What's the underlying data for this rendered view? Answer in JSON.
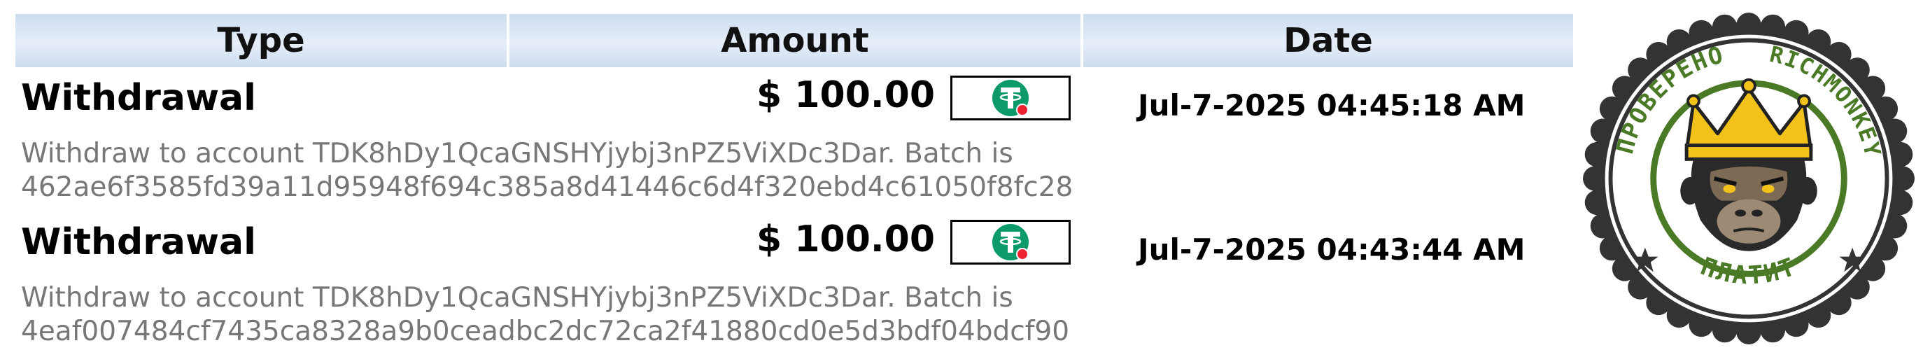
{
  "table": {
    "headers": {
      "type": "Type",
      "amount": "Amount",
      "date": "Date"
    },
    "rows": [
      {
        "type": "Withdrawal",
        "amount": "$ 100.00",
        "payment_method_icon": "tether-usdt-trc20-icon",
        "date": "Jul-7-2025 04:45:18 AM",
        "description_line1": "Withdraw to account TDK8hDy1QcaGNSHYjybj3nPZ5ViXDc3Dar. Batch is",
        "description_line2": "462ae6f3585fd39a11d95948f694c385a8d41446c6d4f320ebd4c61050f8fc28"
      },
      {
        "type": "Withdrawal",
        "amount": "$ 100.00",
        "payment_method_icon": "tether-usdt-trc20-icon",
        "date": "Jul-7-2025 04:43:44 AM",
        "description_line1": "Withdraw to account TDK8hDy1QcaGNSHYjybj3nPZ5ViXDc3Dar. Batch is",
        "description_line2": "4eaf007484cf7435ca8328a9b0ceadbc2dc72ca2f41880cd0e5d3bdf04bdcf90"
      }
    ]
  },
  "badge": {
    "top_left_text": "ПРОВЕРЕНО",
    "top_right_text": "RICHMONKEY",
    "bottom_text": "ПЛАТИТ",
    "icon": "crowned-gorilla-icon"
  },
  "colors": {
    "header_gradient": "#d6e3f3",
    "badge_green": "#4a7a26",
    "badge_dark": "#333333",
    "crown_gold": "#f2c21b",
    "usdt_green": "#0c9a6a",
    "usdt_red_dot": "#ee2233",
    "description_gray": "#777777"
  }
}
